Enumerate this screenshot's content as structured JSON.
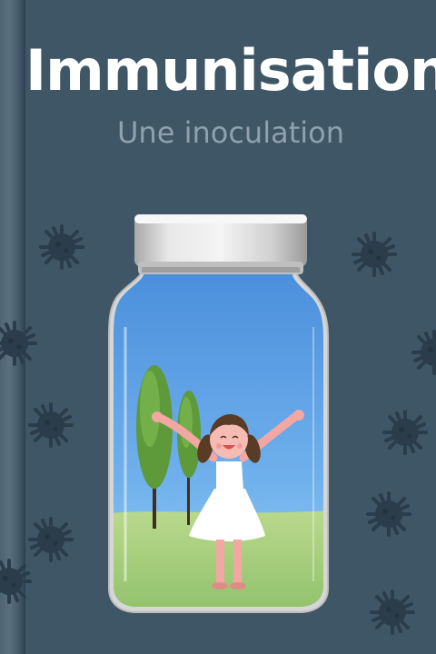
{
  "cover": {
    "title": "Immunisation",
    "subtitle": "Une inoculation"
  },
  "colors": {
    "background": "#3f5666",
    "title": "#ffffff",
    "subtitle": "#8ea1ad",
    "virus": "#2b3d4b",
    "sky": "#5b9de0",
    "grass": "#a8cf7a",
    "cap": "#d9d9d9"
  },
  "illustration": {
    "subject": "girl-with-raised-arms",
    "container": "vaccine-vial",
    "trees": 2,
    "virus_particles": 12
  }
}
